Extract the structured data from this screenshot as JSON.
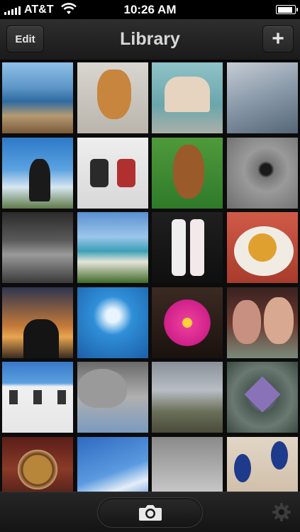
{
  "status_bar": {
    "carrier": "AT&T",
    "time": "10:26 AM",
    "battery_level": 0.92
  },
  "nav": {
    "title": "Library",
    "edit_label": "Edit",
    "add_label": "+"
  },
  "photos": [
    {
      "name": "photo-coastal-cliff",
      "bg": "linear-gradient(180deg,#8fc0e8 0%,#5e97c8 35%,#2f6aa0 55%,#b59a72 75%,#7a5a3a 100%)"
    },
    {
      "name": "photo-golden-puppy",
      "bg": "linear-gradient(180deg,#d9d6cf,#b9b5ad)"
    },
    {
      "name": "photo-friends-cart",
      "bg": "linear-gradient(180deg,#8fc3c7,#6aa6ac 60%,#aab0a8)"
    },
    {
      "name": "photo-cloudy-sky",
      "bg": "linear-gradient(160deg,#c7cdd5,#8898a8 50%,#556677)"
    },
    {
      "name": "photo-windblown-hair",
      "bg": "linear-gradient(180deg,#2e79c8,#5aa2e0 45%,#d7e6ef 70%,#5f7a4a)"
    },
    {
      "name": "photo-snow-chairs",
      "bg": "linear-gradient(180deg,#eeeeee,#d8d8d8)"
    },
    {
      "name": "photo-brown-puppy-grass",
      "bg": "linear-gradient(180deg,#4f9a3b,#2f7a2a)"
    },
    {
      "name": "photo-moon-crater",
      "bg": "radial-gradient(circle at 55% 45%,#1a1a1a 0 10%,#777 15%,#9a9a9a 40%,#6d6d6d 100%)"
    },
    {
      "name": "photo-train-station",
      "bg": "linear-gradient(180deg,#2b2b2b,#5a5a5a 40%,#9a9a9a 60%,#3a3a3a)"
    },
    {
      "name": "photo-beach-cliffs",
      "bg": "linear-gradient(180deg,#5a8fd0,#9cc6ea 35%,#3aa0b5 55%,#e6e4d8 70%,#3f6a2a)"
    },
    {
      "name": "photo-lip-balms",
      "bg": "linear-gradient(180deg,#1f1f1f,#0f0f0f)"
    },
    {
      "name": "photo-food-plate",
      "bg": "linear-gradient(180deg,#d05a48,#a83c2c)"
    },
    {
      "name": "photo-sunset-silhouette",
      "bg": "linear-gradient(180deg,#2e3550,#c57a3a 55%,#e8a550 70%,#3a2a20)"
    },
    {
      "name": "photo-swimmer-pool",
      "bg": "radial-gradient(circle at 50% 40%,#e8f4ff 0 12%,#2f8fd8 35%,#1c5fa8 100%)"
    },
    {
      "name": "photo-pink-flower",
      "bg": "linear-gradient(180deg,#3b2a22,#1a120e)"
    },
    {
      "name": "photo-couple-selfie",
      "bg": "linear-gradient(180deg,#3a2220,#6a3a30 50%,#7a8a7a)"
    },
    {
      "name": "photo-white-building",
      "bg": "linear-gradient(180deg,#3a78c8,#5aa0e0 30%,#f0f0f0 35%,#e6e6e6)"
    },
    {
      "name": "photo-knit-hat",
      "bg": "linear-gradient(180deg,#6a6a6a,#b0b0b0 50%,#7a9abf)"
    },
    {
      "name": "photo-winter-trees",
      "bg": "linear-gradient(180deg,#8a9098,#b8bec4 40%,#6a705a 70%,#4a4a3a)"
    },
    {
      "name": "photo-frosted-leaf",
      "bg": "radial-gradient(circle at 50% 50%,#7a6a9a 0 16%,#4a5a52 30%,#6a7a72 60%,#3a4a42)"
    },
    {
      "name": "photo-coffee-cup",
      "bg": "linear-gradient(180deg,#5a1e18,#8a3a28 45%,#3a1410)"
    },
    {
      "name": "photo-blue-sky-clouds",
      "bg": "linear-gradient(160deg,#2f6ac0,#5a9ae0 50%,#e4eef8 70%,#3a78c8)"
    },
    {
      "name": "photo-snowy-branches",
      "bg": "linear-gradient(180deg,#8a8a8a,#d8d8d8)"
    },
    {
      "name": "photo-sandals-sand",
      "bg": "linear-gradient(180deg,#e2d6c6,#cbb9a2)"
    }
  ]
}
